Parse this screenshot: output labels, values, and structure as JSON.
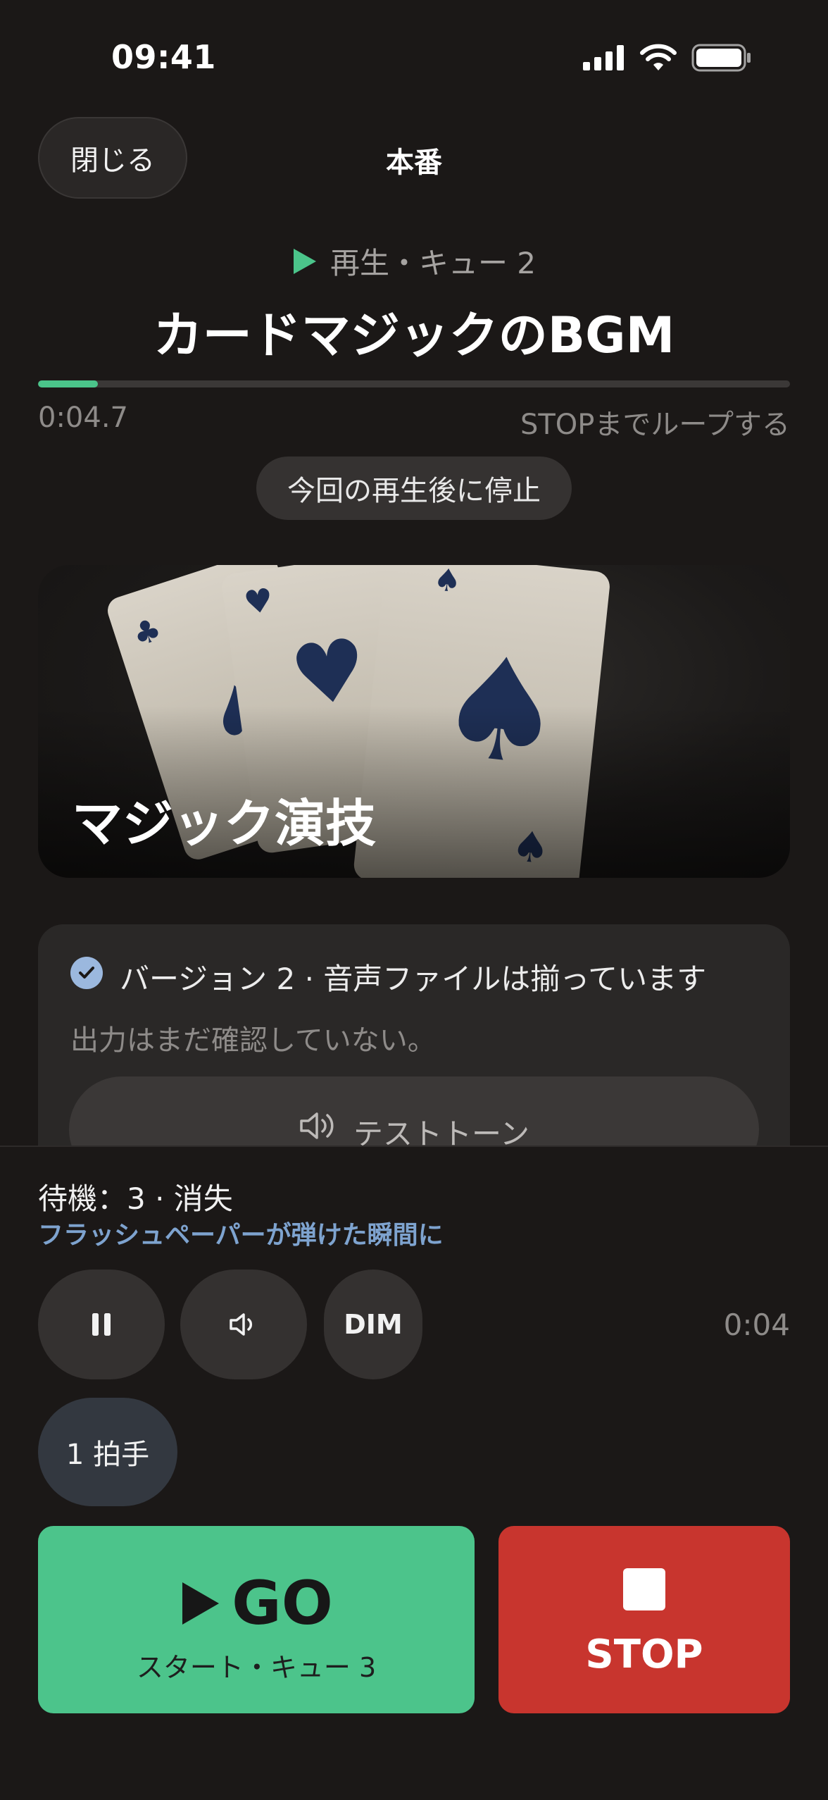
{
  "status_bar": {
    "time": "09:41"
  },
  "header": {
    "close_label": "閉じる",
    "title": "本番"
  },
  "now_playing": {
    "status": "再生・キュー 2",
    "cue_name": "カードマジックのBGM",
    "progress": 0.08,
    "elapsed": "0:04.7",
    "loop_text": "STOPまでループする",
    "stop_after_label": "今回の再生後に停止"
  },
  "artwork": {
    "title": "マジック演技"
  },
  "file_card": {
    "status": "バージョン 2 · 音声ファイルは揃っています",
    "note": "出力はまだ確認していない。",
    "test_tone_label": "テストトーン"
  },
  "panel": {
    "next_cue": "待機：3 · 消失",
    "next_trigger": "フラッシュペーパーが弾けた瞬間に",
    "dim_label": "DIM",
    "time": "0:04",
    "clap_label": "1  拍手"
  },
  "go": {
    "label": "GO",
    "sub": "スタート・キュー 3"
  },
  "stop": {
    "label": "STOP"
  },
  "colors": {
    "accent": "#4bc48a",
    "stop": "#c8352e",
    "link": "#7ea3cf",
    "background": "#1b1817"
  }
}
